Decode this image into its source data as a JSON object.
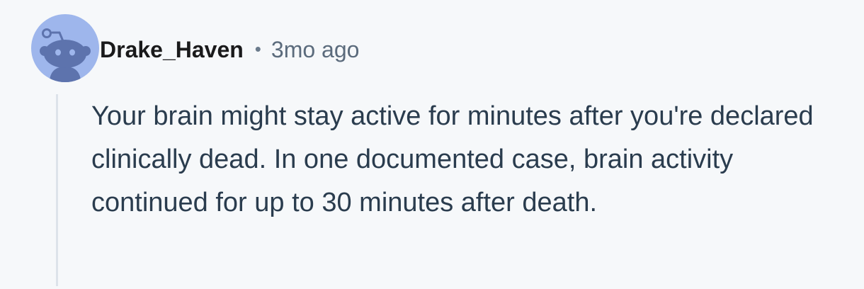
{
  "comment": {
    "author": "Drake_Haven",
    "separator": "•",
    "timestamp": "3mo ago",
    "body": "Your brain might stay active for minutes after you're declared clinically dead. In one documented case, brain activity continued for up to 30 minutes after death.",
    "avatar_icon": "reddit-snoo-avatar-icon",
    "colors": {
      "background": "#f6f8fa",
      "avatar_bg": "#9eb6ec",
      "avatar_figure": "#5d73ad",
      "username": "#1a1a1b",
      "meta": "#5b6b7c",
      "body_text": "#2a3c4e",
      "thread_line": "#dde3ea"
    }
  }
}
